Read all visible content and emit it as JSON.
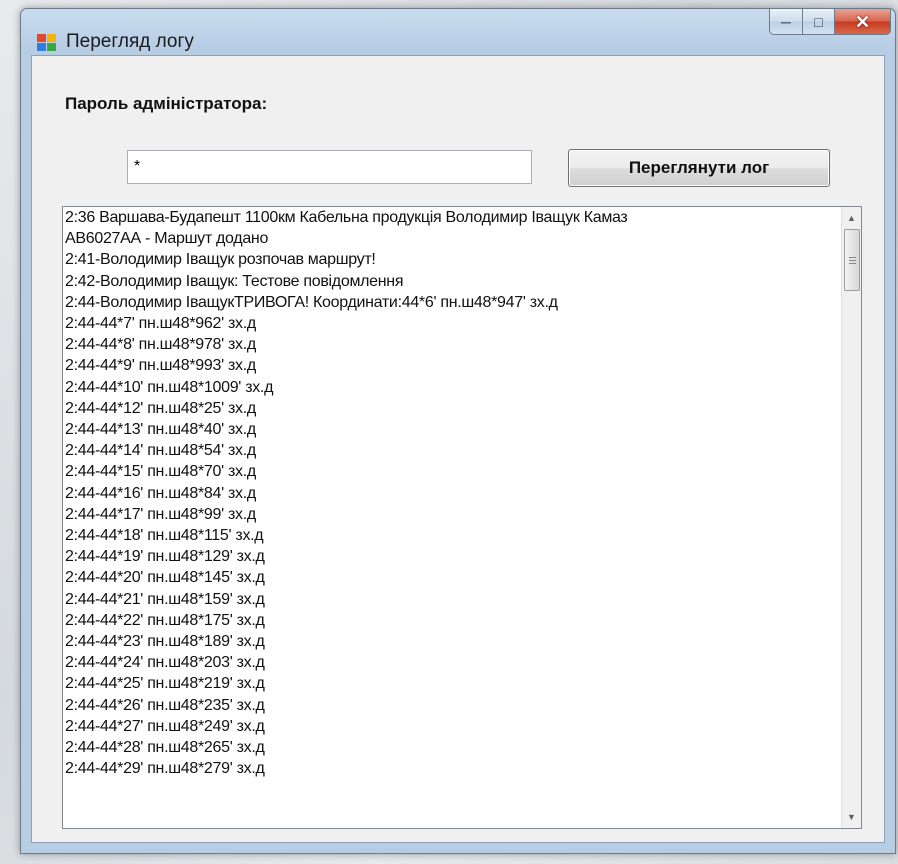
{
  "window": {
    "title": "Перегляд логу",
    "icons": {
      "app": "app-icon",
      "minimize": "minimize-icon",
      "maximize": "maximize-icon",
      "close": "close-icon"
    }
  },
  "form": {
    "password_label": "Пароль адміністратора:",
    "password_value": "*",
    "view_button_label": "Переглянути лог"
  },
  "log": {
    "lines": [
      "2:36 Варшава-Будапешт 1100км Кабельна продукція Володимир Іващук Камаз",
      "АВ6027АА - Маршут додано",
      "2:41-Володимир Іващук розпочав маршрут!",
      "2:42-Володимир Іващук: Тестове повідомлення",
      "2:44-Володимир ІващукТРИВОГА! Координати:44*6' пн.ш48*947' зх.д",
      "2:44-44*7' пн.ш48*962' зх.д",
      "2:44-44*8' пн.ш48*978' зх.д",
      "2:44-44*9' пн.ш48*993' зх.д",
      "2:44-44*10' пн.ш48*1009' зх.д",
      "2:44-44*12' пн.ш48*25' зх.д",
      "2:44-44*13' пн.ш48*40' зх.д",
      "2:44-44*14' пн.ш48*54' зх.д",
      "2:44-44*15' пн.ш48*70' зх.д",
      "2:44-44*16' пн.ш48*84' зх.д",
      "2:44-44*17' пн.ш48*99' зх.д",
      "2:44-44*18' пн.ш48*115' зх.д",
      "2:44-44*19' пн.ш48*129' зх.д",
      "2:44-44*20' пн.ш48*145' зх.д",
      "2:44-44*21' пн.ш48*159' зх.д",
      "2:44-44*22' пн.ш48*175' зх.д",
      "2:44-44*23' пн.ш48*189' зх.д",
      "2:44-44*24' пн.ш48*203' зх.д",
      "2:44-44*25' пн.ш48*219' зх.д",
      "2:44-44*26' пн.ш48*235' зх.д",
      "2:44-44*27' пн.ш48*249' зх.д",
      "2:44-44*28' пн.ш48*265' зх.д",
      "2:44-44*29' пн.ш48*279' зх.д"
    ]
  },
  "colors": {
    "title_bar": "#b7cde4",
    "close_button": "#c73a1e",
    "client": "#f0f0f0"
  }
}
